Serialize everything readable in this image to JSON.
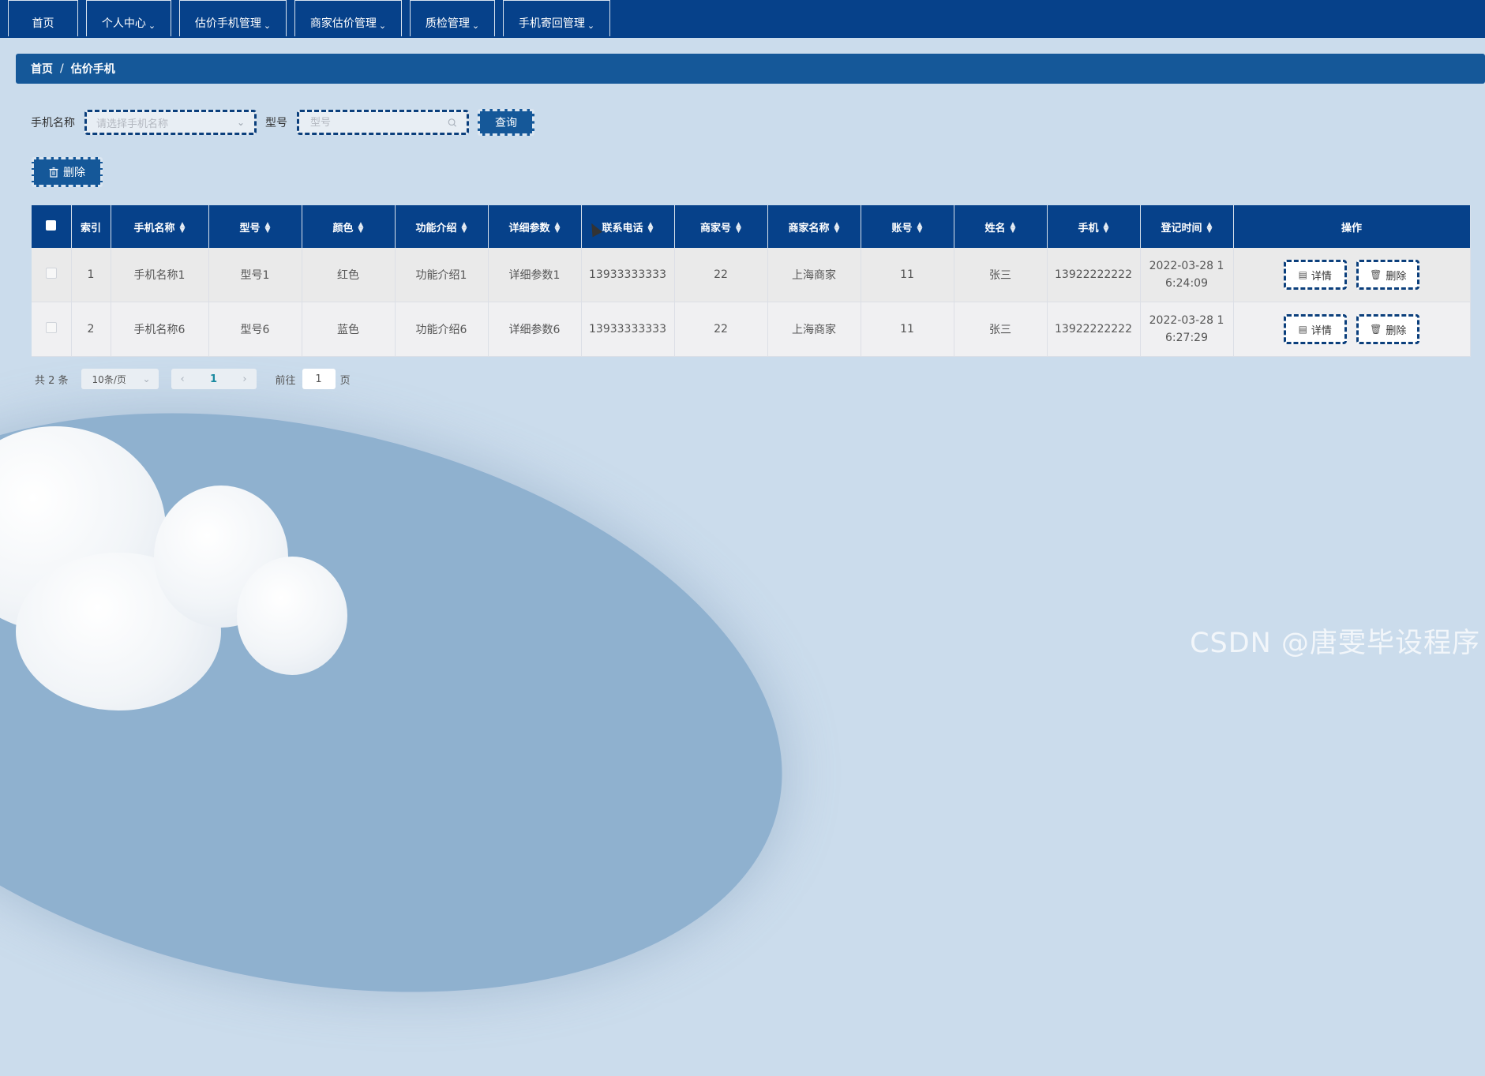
{
  "nav": {
    "items": [
      {
        "label": "首页",
        "has_menu": false
      },
      {
        "label": "个人中心",
        "has_menu": true
      },
      {
        "label": "估价手机管理",
        "has_menu": true
      },
      {
        "label": "商家估价管理",
        "has_menu": true
      },
      {
        "label": "质检管理",
        "has_menu": true
      },
      {
        "label": "手机寄回管理",
        "has_menu": true
      }
    ],
    "chevron": "⌄"
  },
  "breadcrumb": {
    "home": "首页",
    "separator": "/",
    "current": "估价手机"
  },
  "search": {
    "name_label": "手机名称",
    "name_placeholder": "请选择手机名称",
    "model_label": "型号",
    "model_placeholder": "型号",
    "query_button": "查询"
  },
  "toolbar": {
    "delete_label": "删除"
  },
  "table": {
    "columns": [
      "索引",
      "手机名称",
      "型号",
      "颜色",
      "功能介绍",
      "详细参数",
      "联系电话",
      "商家号",
      "商家名称",
      "账号",
      "姓名",
      "手机",
      "登记时间",
      "操作"
    ],
    "rows": [
      {
        "index": "1",
        "name": "手机名称1",
        "model": "型号1",
        "color": "红色",
        "feature": "功能介绍1",
        "params": "详细参数1",
        "phone": "13933333333",
        "merchant_no": "22",
        "merchant_name": "上海商家",
        "account": "11",
        "person": "张三",
        "mobile": "13922222222",
        "time_line1": "2022-03-28 1",
        "time_line2": "6:24:09"
      },
      {
        "index": "2",
        "name": "手机名称6",
        "model": "型号6",
        "color": "蓝色",
        "feature": "功能介绍6",
        "params": "详细参数6",
        "phone": "13933333333",
        "merchant_no": "22",
        "merchant_name": "上海商家",
        "account": "11",
        "person": "张三",
        "mobile": "13922222222",
        "time_line1": "2022-03-28 1",
        "time_line2": "6:27:29"
      }
    ],
    "actions": {
      "detail": "详情",
      "delete": "删除"
    }
  },
  "pagination": {
    "total": "共 2 条",
    "page_size": "10条/页",
    "prev": "‹",
    "current": "1",
    "next": "›",
    "goto_label": "前往",
    "goto_value": "1",
    "goto_suffix": "页"
  },
  "watermark": "CSDN @唐雯毕设程序",
  "colors": {
    "nav_bg": "#06418a",
    "breadcrumb_bg": "#155899",
    "page_bg": "#cbdcec",
    "accent_border": "#0b3f7c"
  }
}
